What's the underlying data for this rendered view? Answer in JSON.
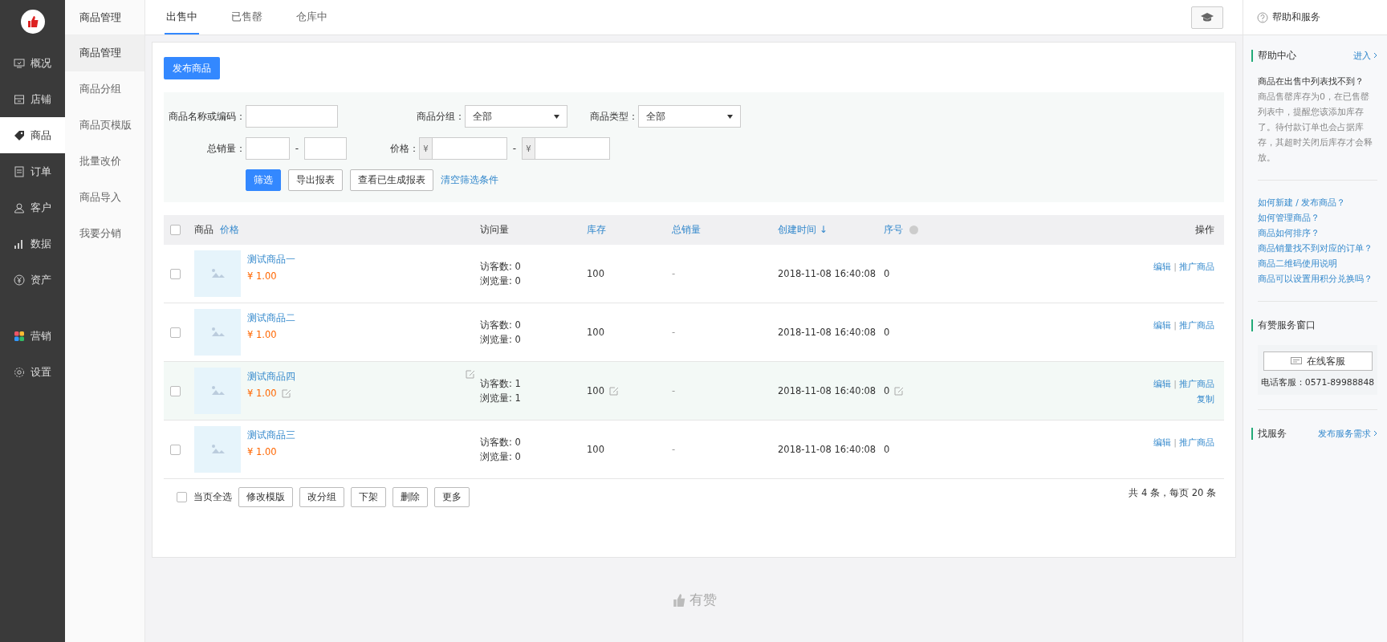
{
  "nav": [
    {
      "label": "概况",
      "kind": "overview",
      "selected": false
    },
    {
      "label": "店铺",
      "kind": "store",
      "selected": false
    },
    {
      "label": "商品",
      "kind": "tag",
      "selected": true
    },
    {
      "label": "订单",
      "kind": "order",
      "selected": false
    },
    {
      "label": "客户",
      "kind": "user",
      "selected": false
    },
    {
      "label": "数据",
      "kind": "chart",
      "selected": false
    },
    {
      "label": "资产",
      "kind": "yuan",
      "selected": false
    },
    {
      "label": "营销",
      "kind": "apps",
      "selected": false
    },
    {
      "label": "设置",
      "kind": "gear",
      "selected": false
    }
  ],
  "subnav": {
    "title": "商品管理",
    "items": [
      {
        "label": "商品管理",
        "selected": true
      },
      {
        "label": "商品分组",
        "selected": false
      },
      {
        "label": "商品页模版",
        "selected": false
      },
      {
        "label": "批量改价",
        "selected": false
      },
      {
        "label": "商品导入",
        "selected": false
      },
      {
        "label": "我要分销",
        "selected": false
      }
    ]
  },
  "tabs": [
    {
      "label": "出售中",
      "selected": true
    },
    {
      "label": "已售罄",
      "selected": false
    },
    {
      "label": "仓库中",
      "selected": false
    }
  ],
  "publish_button": "发布商品",
  "filters": {
    "name_label": "商品名称或编码：",
    "group_label": "商品分组：",
    "group_value": "全部",
    "type_label": "商品类型：",
    "type_value": "全部",
    "sales_label": "总销量：",
    "range_dash": "-",
    "price_label": "价格：",
    "currency": "¥",
    "buttons": [
      {
        "label": "筛选",
        "kind": "primary"
      },
      {
        "label": "导出报表",
        "kind": "default"
      },
      {
        "label": "查看已生成报表",
        "kind": "default"
      }
    ],
    "clear_link": "清空筛选条件"
  },
  "table": {
    "header_checked": false,
    "action_separator": "|",
    "columns": [
      {
        "label": "商品",
        "link": false
      },
      {
        "label": "价格",
        "link": true
      },
      {
        "label": "访问量",
        "link": false
      },
      {
        "label": "库存",
        "link": true
      },
      {
        "label": "总销量",
        "link": true
      },
      {
        "label": "创建时间 ↓",
        "link": true
      },
      {
        "label": "序号",
        "link": true
      },
      {
        "label": "操作",
        "link": false
      }
    ],
    "rows": [
      {
        "name": "测试商品一",
        "price": "¥ 1.00",
        "visitors": "访客数: 0",
        "views": "浏览量: 0",
        "stock": "100",
        "sales": "-",
        "created": "2018-11-08 16:40:08",
        "seq": "0",
        "actions": [
          "编辑",
          "推广商品"
        ],
        "extra_action": null,
        "highlighted": false,
        "checked": false
      },
      {
        "name": "测试商品二",
        "price": "¥ 1.00",
        "visitors": "访客数: 0",
        "views": "浏览量: 0",
        "stock": "100",
        "sales": "-",
        "created": "2018-11-08 16:40:08",
        "seq": "0",
        "actions": [
          "编辑",
          "推广商品"
        ],
        "extra_action": null,
        "highlighted": false,
        "checked": false
      },
      {
        "name": "测试商品四",
        "price": "¥ 1.00",
        "visitors": "访客数: 1",
        "views": "浏览量: 1",
        "stock": "100",
        "sales": "-",
        "created": "2018-11-08 16:40:08",
        "seq": "0",
        "actions": [
          "编辑",
          "推广商品"
        ],
        "extra_action": "复制",
        "highlighted": true,
        "checked": false
      },
      {
        "name": "测试商品三",
        "price": "¥ 1.00",
        "visitors": "访客数: 0",
        "views": "浏览量: 0",
        "stock": "100",
        "sales": "-",
        "created": "2018-11-08 16:40:08",
        "seq": "0",
        "actions": [
          "编辑",
          "推广商品"
        ],
        "extra_action": null,
        "highlighted": false,
        "checked": false
      }
    ]
  },
  "bulk": {
    "select_all": "当页全选",
    "checked": false,
    "buttons": [
      "修改模版",
      "改分组",
      "下架",
      "删除",
      "更多"
    ],
    "summary": "共 4 条，每页 20 条"
  },
  "footer_brand": "有赞",
  "help": {
    "title": "帮助和服务",
    "center_title": "帮助中心",
    "enter": "进入",
    "question": "商品在出售中列表找不到？",
    "answer": "商品售罄库存为0，在已售罄列表中，提醒您该添加库存了。待付款订单也会占据库存，其超时关闭后库存才会释放。",
    "links": [
      "如何新建 / 发布商品？",
      "如何管理商品？",
      "商品如何排序？",
      "商品销量找不到对应的订单？",
      "商品二维码使用说明",
      "商品可以设置用积分兑换吗？"
    ],
    "service_title": "有赞服务窗口",
    "online_button": "在线客服",
    "phone": "电话客服：0571-89988848",
    "find_title": "找服务",
    "find_link": "发布服务需求"
  }
}
